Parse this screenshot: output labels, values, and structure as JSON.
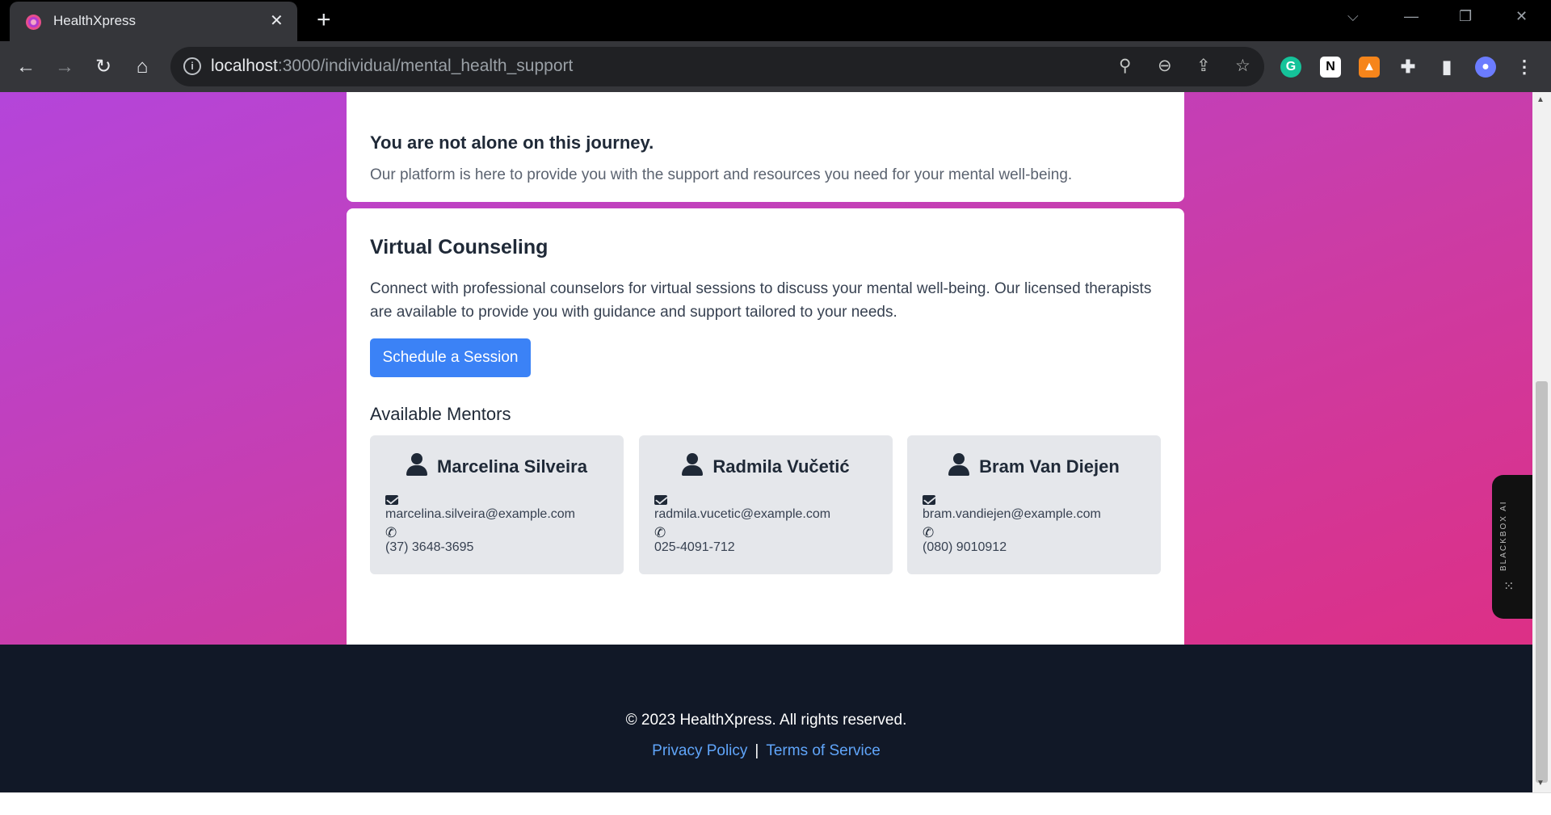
{
  "browser": {
    "tab_title": "HealthXpress",
    "tab_close": "✕",
    "new_tab": "+",
    "url_host": "localhost",
    "url_path": ":3000/individual/mental_health_support"
  },
  "intro": {
    "heading": "You are not alone on this journey.",
    "text": "Our platform is here to provide you with the support and resources you need for your mental well-being."
  },
  "counseling": {
    "heading": "Virtual Counseling",
    "text": "Connect with professional counselors for virtual sessions to discuss your mental well-being. Our licensed therapists are available to provide you with guidance and support tailored to your needs.",
    "button_label": "Schedule a Session"
  },
  "mentors": {
    "heading": "Available Mentors",
    "items": [
      {
        "name": "Marcelina Silveira",
        "email": "marcelina.silveira@example.com",
        "phone": "(37) 3648-3695"
      },
      {
        "name": "Radmila Vučetić",
        "email": "radmila.vucetic@example.com",
        "phone": "025-4091-712"
      },
      {
        "name": "Bram Van Diejen",
        "email": "bram.vandiejen@example.com",
        "phone": "(080) 9010912"
      }
    ]
  },
  "blackbox": {
    "label": "BLACKBOX AI"
  },
  "footer": {
    "copyright": "© 2023 HealthXpress. All rights reserved.",
    "privacy": "Privacy Policy",
    "separator": "|",
    "terms": "Terms of Service"
  },
  "colors": {
    "accent": "#3b82f6",
    "gradient_start": "#b445da",
    "gradient_end": "#e22c7c",
    "footer_bg": "#111827",
    "link": "#60a5fa"
  }
}
